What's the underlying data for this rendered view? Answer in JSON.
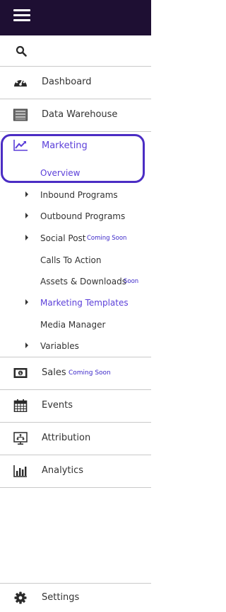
{
  "topbar": {
    "menu_icon": "hamburger-icon"
  },
  "search": {
    "icon": "search-icon"
  },
  "nav": {
    "dashboard": {
      "label": "Dashboard",
      "icon": "dashboard-gauge-icon"
    },
    "data_warehouse": {
      "label": "Data Warehouse",
      "icon": "server-rack-icon"
    },
    "marketing": {
      "label": "Marketing",
      "icon": "line-chart-icon",
      "overview": "Overview",
      "sub_items": [
        {
          "label": "Inbound Programs",
          "expandable": true
        },
        {
          "label": "Outbound Programs",
          "expandable": true
        },
        {
          "label": "Social Post",
          "expandable": true,
          "badge": "Coming Soon"
        },
        {
          "label": "Calls To Action",
          "expandable": false
        },
        {
          "label": "Assets & Downloads",
          "expandable": false,
          "badge": "Soon"
        },
        {
          "label": "Marketing Templates",
          "expandable": true,
          "active": true
        },
        {
          "label": "Media Manager",
          "expandable": false
        },
        {
          "label": "Variables",
          "expandable": true
        }
      ]
    },
    "sales": {
      "label": "Sales",
      "icon": "money-bill-icon",
      "badge": "Coming Soon"
    },
    "events": {
      "label": "Events",
      "icon": "calendar-icon"
    },
    "attribution": {
      "label": "Attribution",
      "icon": "attribution-icon"
    },
    "analytics": {
      "label": "Analytics",
      "icon": "bar-chart-icon"
    },
    "settings": {
      "label": "Settings",
      "icon": "gear-icon"
    }
  },
  "colors": {
    "topbar_bg": "#1e0f33",
    "accent": "#5b3fd9",
    "highlight_border": "#4b2dc4",
    "badge": "#3b27c9",
    "divider": "#c9c9c9"
  }
}
